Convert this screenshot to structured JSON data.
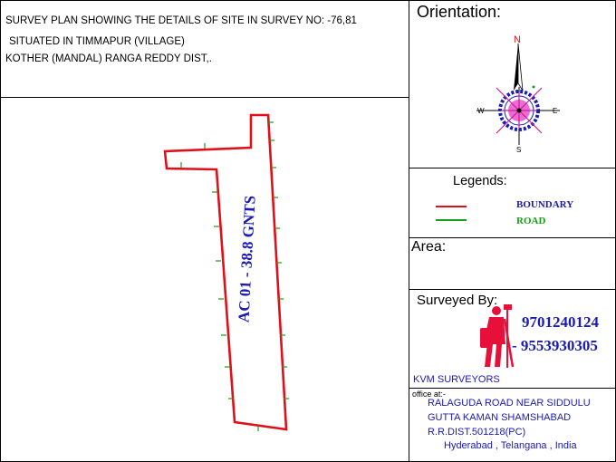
{
  "title": {
    "line1": "SURVEY PLAN SHOWING THE DETAILS OF SITE IN SURVEY NO: -76,81",
    "line2": "SITUATED IN TIMMAPUR (VILLAGE)",
    "line3": "KOTHER (MANDAL) RANGA REDDY DIST,."
  },
  "orientation": {
    "heading": "Orientation:",
    "north": "N",
    "south": "S",
    "east": "E",
    "west": "W"
  },
  "plot": {
    "label": "AC 01 - 38.8 GNTS",
    "boundary_color": "#e0101a",
    "road_color": "#14a014"
  },
  "legends": {
    "heading": "Legends:",
    "items": [
      {
        "label": "BOUNDARY",
        "color": "#e0101a"
      },
      {
        "label": "ROAD",
        "color": "#14a014"
      }
    ]
  },
  "area": {
    "heading": "Area:"
  },
  "surveyed": {
    "heading": "Surveyed By:",
    "phone1": "9701240124",
    "phone2": "- 9553930305",
    "company": "KVM SURVEYORS",
    "office_label": "office at:-",
    "address": [
      "RALAGUDA ROAD NEAR SIDDULU",
      "GUTTA KAMAN SHAMSHABAD",
      "R.R.DIST.501218(PC)",
      "Hyderabad , Telangana , India"
    ],
    "text_color": "#1a1ab4"
  }
}
